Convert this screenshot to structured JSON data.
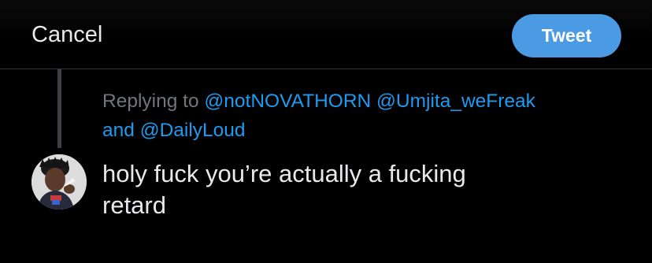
{
  "header": {
    "cancel_label": "Cancel",
    "tweet_label": "Tweet"
  },
  "reply_context": {
    "prefix": "Replying to",
    "mentions": [
      "@notNOVATHORN",
      "@Umjita_weFreak",
      "@DailyLoud"
    ],
    "conjunction": "and"
  },
  "compose": {
    "text_line1": "holy fuck you’re actually a fucking",
    "text_line2": "retard"
  },
  "colors": {
    "accent": "#1d9bf0",
    "button": "#4a9ae4",
    "background": "#000000",
    "muted": "#71767b",
    "text": "#e7e9ea"
  },
  "icons": {
    "avatar": "user-avatar-photo"
  }
}
